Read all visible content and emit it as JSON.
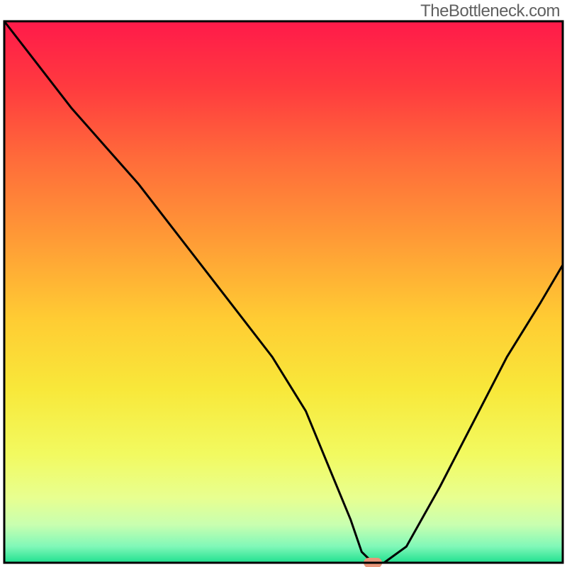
{
  "watermark": "TheBottleneck.com",
  "chart_data": {
    "type": "line",
    "title": "",
    "xlabel": "",
    "ylabel": "",
    "xlim": [
      0,
      100
    ],
    "ylim": [
      0,
      100
    ],
    "x": [
      0,
      6,
      12,
      18,
      24,
      30,
      36,
      42,
      48,
      54,
      58,
      62,
      64,
      66,
      68,
      72,
      78,
      84,
      90,
      96,
      100
    ],
    "values": [
      100,
      92,
      84,
      77,
      70,
      62,
      54,
      46,
      38,
      28,
      18,
      8,
      2,
      0,
      0,
      3,
      14,
      26,
      38,
      48,
      55
    ],
    "marker": {
      "x": 66,
      "y": 0,
      "color": "#e9967a"
    },
    "gradient_stops": [
      {
        "offset": 0.0,
        "color": "#ff1a4a"
      },
      {
        "offset": 0.12,
        "color": "#ff3a3f"
      },
      {
        "offset": 0.25,
        "color": "#ff6a3a"
      },
      {
        "offset": 0.4,
        "color": "#ff9a36"
      },
      {
        "offset": 0.55,
        "color": "#ffcc33"
      },
      {
        "offset": 0.68,
        "color": "#f8e83a"
      },
      {
        "offset": 0.8,
        "color": "#f2fa60"
      },
      {
        "offset": 0.88,
        "color": "#e8ff90"
      },
      {
        "offset": 0.93,
        "color": "#c8ffb0"
      },
      {
        "offset": 0.97,
        "color": "#80f8b8"
      },
      {
        "offset": 1.0,
        "color": "#20e090"
      }
    ],
    "frame_color": "#000000",
    "line_color": "#000000",
    "line_width": 3
  }
}
